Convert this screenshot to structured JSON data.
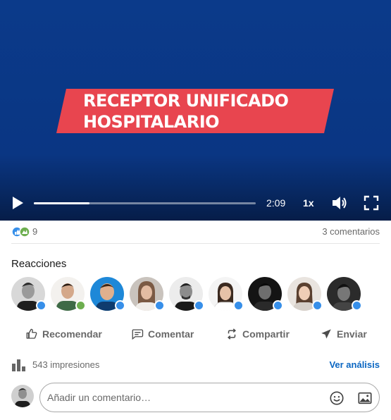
{
  "video": {
    "title_line1": "RECEPTOR UNIFICADO",
    "title_line2": "HOSPITALARIO",
    "duration": "2:09",
    "speed": "1x",
    "progress": 0.25,
    "background_color": "#0b3a8a",
    "banner_color": "#e8454f"
  },
  "social": {
    "reaction_count": "9",
    "comments": "3 comentarios",
    "reactions_title": "Reacciones",
    "reactor_avatars": [
      "avatar-1",
      "avatar-2",
      "avatar-3",
      "avatar-4",
      "avatar-5",
      "avatar-6",
      "avatar-7",
      "avatar-8",
      "avatar-9"
    ]
  },
  "actions": {
    "recommend": "Recomendar",
    "comment": "Comentar",
    "share": "Compartir",
    "send": "Enviar"
  },
  "analytics": {
    "impressions": "543 impresiones",
    "link": "Ver análisis"
  },
  "comment_box": {
    "placeholder": "Añadir un comentario…",
    "value": ""
  },
  "colors": {
    "link_blue": "#0a66c2",
    "like_blue": "#378fe9"
  }
}
